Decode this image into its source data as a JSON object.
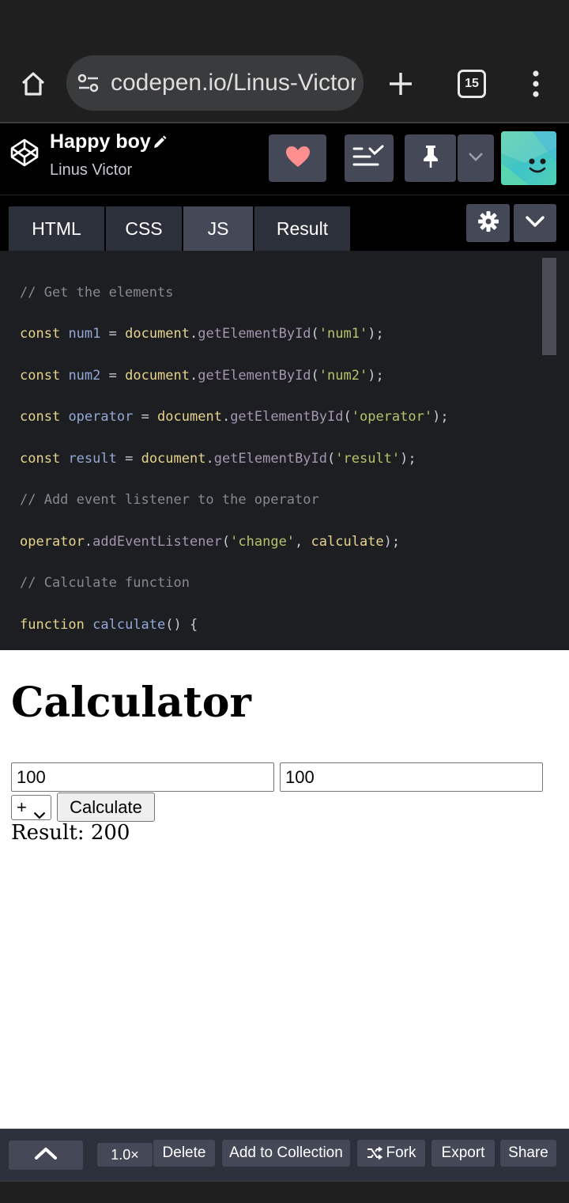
{
  "browser": {
    "url": "codepen.io/Linus-Victor",
    "tab_count": "15"
  },
  "pen": {
    "title": "Happy boy",
    "author": "Linus Victor"
  },
  "tabs": [
    "HTML",
    "CSS",
    "JS",
    "Result"
  ],
  "code_lines": [
    "// Get the elements",
    "const num1 = document.getElementById('num1');",
    "const num2 = document.getElementById('num2');",
    "const operator = document.getElementById('operator');",
    "const result = document.getElementById('result');",
    "// Add event listener to the operator",
    "operator.addEventListener('change', calculate);",
    "// Calculate function",
    "function calculate() {"
  ],
  "result_pane": {
    "heading": "Calculator",
    "num1_value": "100",
    "num2_value": "100",
    "operator_selected": "+",
    "calculate_label": "Calculate",
    "result_text": "Result: 200"
  },
  "footer": {
    "zoom": "1.0×",
    "delete_label": "Delete",
    "add_to_collection_label": "Add to Collection",
    "fork_label": "Fork",
    "export_label": "Export",
    "share_label": "Share"
  }
}
